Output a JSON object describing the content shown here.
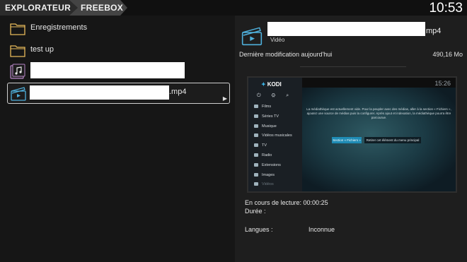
{
  "breadcrumb": {
    "root": "EXPLORATEUR",
    "current": "FREEBOX"
  },
  "clock": "10:53",
  "files": [
    {
      "name": "Enregistrements",
      "type": "folder"
    },
    {
      "name": "test up",
      "type": "folder"
    },
    {
      "name": "",
      "type": "audio"
    },
    {
      "name": ".mp4",
      "type": "video",
      "selected": true
    }
  ],
  "details": {
    "title_suffix": "mp4",
    "type_label": "Vidéo",
    "modified": "Dernière modification aujourd'hui",
    "size": "490,16 Mo",
    "preview": {
      "app_name": "KODI",
      "clock": "15:26",
      "menu": [
        "Films",
        "Séries TV",
        "Musique",
        "Vidéos musicales",
        "TV",
        "Radio",
        "Extensions",
        "Images",
        "Vidéos"
      ],
      "message": "La médiathèque est actuellement vide. Pour la peupler avec des médias, aller à la section « Fichiers », ajoutez une source de médias puis la configurer. Après ajout et indexation, la médiathèque pourra être parcourue.",
      "button_primary": "Section « Fichiers »",
      "button_secondary": "Retirer cet élément du menu principal"
    },
    "playback": "En cours de lecture: 00:00:25",
    "duration": "Durée :",
    "languages_label": "Langues :",
    "languages_value": "Inconnue"
  }
}
